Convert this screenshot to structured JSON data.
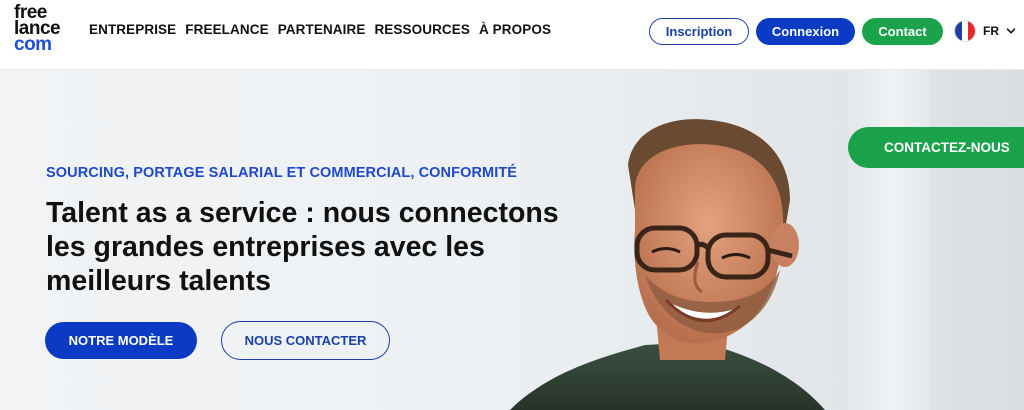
{
  "header": {
    "logo": {
      "line1": "free",
      "line2": "lance",
      "line3": "com"
    },
    "nav": [
      "ENTREPRISE",
      "FREELANCE",
      "PARTENAIRE",
      "RESSOURCES",
      "À PROPOS"
    ],
    "buttons": {
      "inscription": "Inscription",
      "connexion": "Connexion",
      "contact": "Contact"
    },
    "language": {
      "code": "FR",
      "icon": "france-flag-icon"
    }
  },
  "hero": {
    "kicker": "SOURCING, PORTAGE SALARIAL ET COMMERCIAL, CONFORMITÉ",
    "headline": "Talent as a service : nous connectons les grandes entreprises avec les meilleurs talents",
    "primary_button": "NOTRE MODÈLE",
    "secondary_button": "NOUS CONTACTER",
    "side_cta": "CONTACTEZ-NOUS"
  },
  "colors": {
    "brand_blue": "#0b3bc4",
    "brand_green": "#1aa34a",
    "text_dark": "#111111"
  }
}
